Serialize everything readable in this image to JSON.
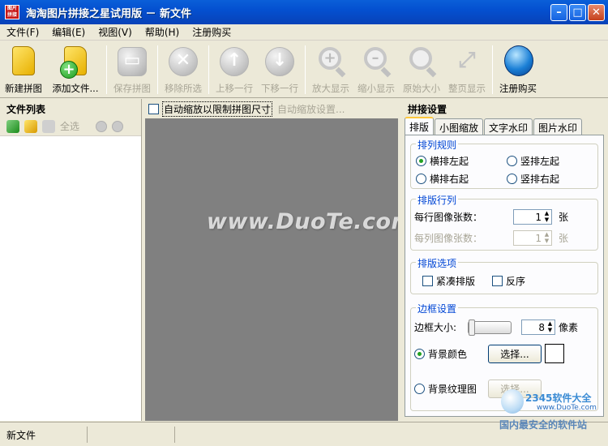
{
  "window": {
    "title": "淘淘图片拼接之星试用版 － 新文件",
    "app_icon_text": "图片拼接",
    "buttons": {
      "minimize": "–",
      "maximize": "□",
      "close": "✕"
    }
  },
  "menu": [
    "文件(F)",
    "编辑(E)",
    "视图(V)",
    "帮助(H)",
    "注册购买"
  ],
  "toolbar": {
    "new": "新建拼图",
    "add": "添加文件...",
    "save": "保存拼图",
    "remove": "移除所选",
    "move_up": "上移一行",
    "move_down": "下移一行",
    "zoom_in": "放大显示",
    "zoom_out": "缩小显示",
    "original": "原始大小",
    "fit": "整页显示",
    "register": "注册购买"
  },
  "left_panel": {
    "title": "文件列表",
    "select_all": "全选"
  },
  "center": {
    "auto_scale_label": "自动缩放以限制拼图尺寸",
    "auto_settings": "自动缩放设置...",
    "watermark": "www.DuoTe.com"
  },
  "right_panel": {
    "title": "拼接设置",
    "tabs": [
      "排版",
      "小图缩放",
      "文字水印",
      "图片水印"
    ],
    "arrangement": {
      "title": "排列规则",
      "options": [
        "横排左起",
        "竖排左起",
        "横排右起",
        "竖排右起"
      ]
    },
    "rows_cols": {
      "title": "排版行列",
      "per_row_label": "每行图像张数：",
      "per_row_value": "1",
      "per_col_label": "每列图像张数：",
      "per_col_value": "1",
      "unit": "张"
    },
    "layout_options": {
      "title": "排版选项",
      "compact": "紧凑排版",
      "reverse": "反序"
    },
    "border": {
      "title": "边框设置",
      "size_label": "边框大小:",
      "size_value": "8",
      "size_unit": "像素",
      "bg_color": "背景颜色",
      "choose": "选择...",
      "bg_texture": "背景纹理图",
      "choose2": "选择..."
    }
  },
  "statusbar": {
    "file": "新文件"
  },
  "brand": {
    "top": "2345软件大全",
    "url": "www.DuoTe.com",
    "bottom": "国内最安全的软件站"
  }
}
